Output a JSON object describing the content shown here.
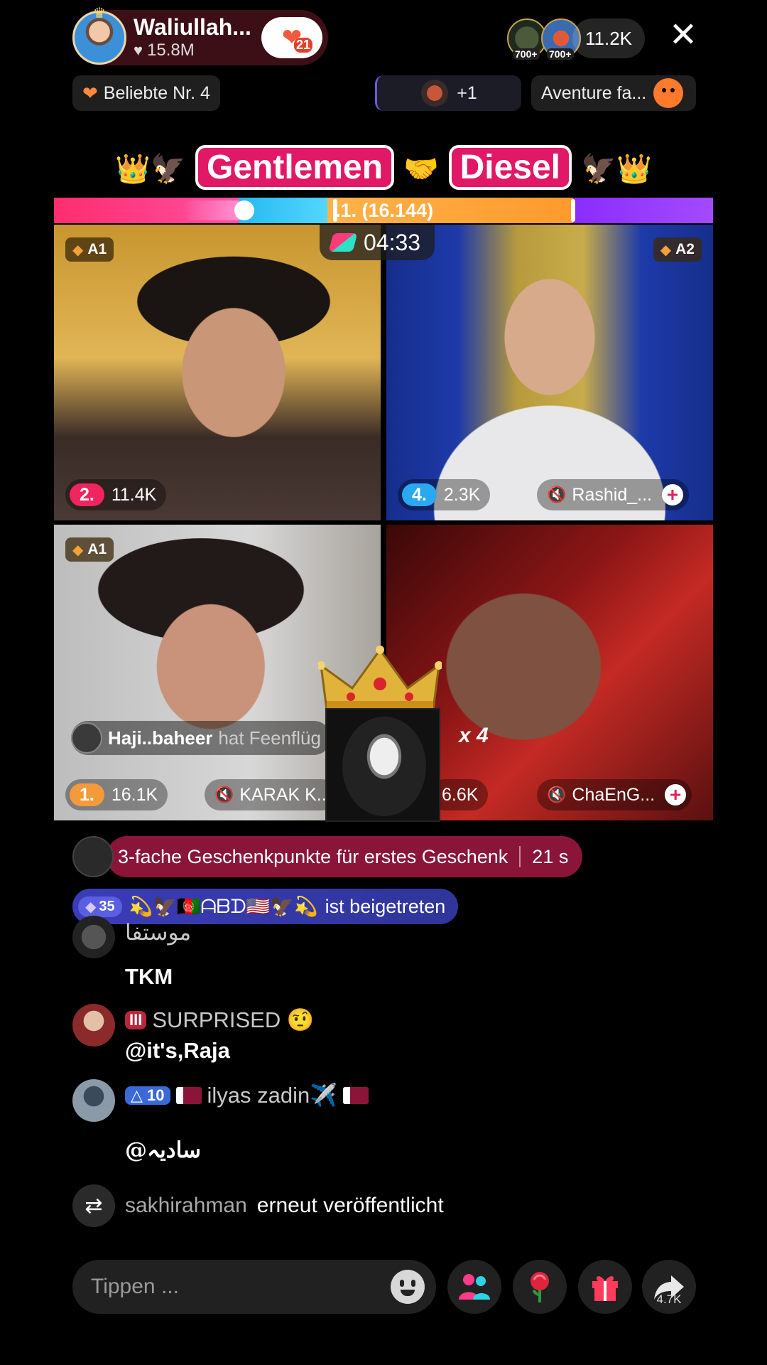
{
  "host": {
    "name": "Waliullah...",
    "likes": "15.8M",
    "fan_count": "21"
  },
  "viewers": {
    "avatar_tags": [
      "700+",
      "700+"
    ],
    "count": "11.2K"
  },
  "chips": {
    "rank": "Beliebte Nr. 4",
    "plus": "+1",
    "adventure": "Aventure fa..."
  },
  "battle": {
    "title_left": "Gentlemen",
    "title_right": "Diesel",
    "score_label": ".1. (16.144)",
    "timer": "04:33"
  },
  "tiles": [
    {
      "level": "A1",
      "rank": "2.",
      "score": "11.4K",
      "rank_color": "#f0245e"
    },
    {
      "level": "A2",
      "rank": "4.",
      "score": "2.3K",
      "rank_color": "#2aa8f0",
      "name": "Rashid_..."
    },
    {
      "level": "A1",
      "rank": "1.",
      "score": "16.1K",
      "rank_color": "#f59a3a",
      "name": "KARAK K..."
    },
    {
      "score": "6.6K",
      "rank_color": "#8a2cff",
      "name": "ChaEnG..."
    }
  ],
  "gift_toast": {
    "user": "Haji..baheer",
    "text": "hat Feenflüg",
    "multiplier": "x 4"
  },
  "promo": {
    "text": "3-fache Geschenkpunkte für erstes Geschenk",
    "time": "21 s"
  },
  "join": {
    "level": "35",
    "user": "💫🦅🇦🇫ᗩᗷᗪ🇺🇸🦅💫",
    "text": "ist beigetreten"
  },
  "chat": [
    {
      "name": "موستفا",
      "text": "TKM"
    },
    {
      "badge": "III",
      "name": "SURPRISED 🤨",
      "text": "@it's,Raja"
    },
    {
      "badge": "10",
      "name": "ilyas zadin✈️",
      "text": "@سادیہ"
    }
  ],
  "repost": {
    "user": "sakhirahman",
    "text": "erneut veröffentlicht"
  },
  "bottom": {
    "input_placeholder": "Tippen ...",
    "share_count": "4.7K"
  }
}
